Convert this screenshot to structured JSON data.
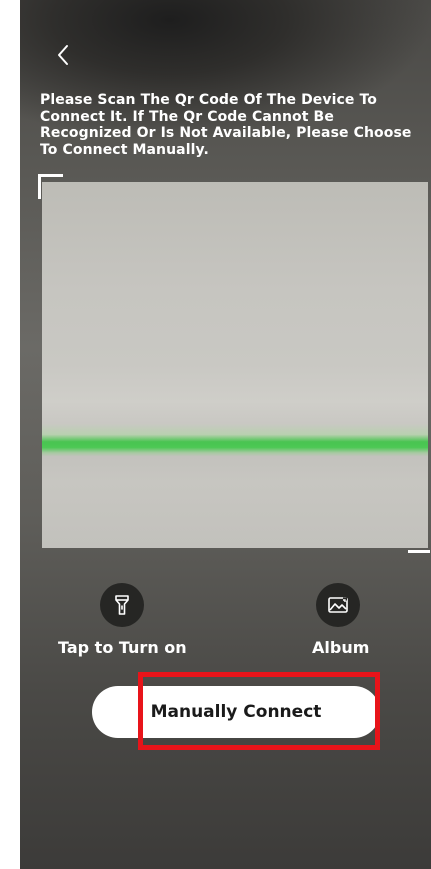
{
  "header": {
    "back_glyph": "‹",
    "instructions": "Please Scan The Qr Code Of The Device To Connect It. If The Qr Code Cannot Be Recognized Or Is Not Available, Please Choose To Connect Manually."
  },
  "scanner": {
    "accent_color": "#4cc854",
    "frame_color": "#ffffff"
  },
  "tools": {
    "flashlight": {
      "icon": "flashlight-icon",
      "label": "Tap to Turn on"
    },
    "album": {
      "icon": "image-icon",
      "label": "Album"
    }
  },
  "actions": {
    "manual_connect_label": "Manually Connect"
  },
  "overlay": {
    "highlight_color": "#e8141a"
  }
}
